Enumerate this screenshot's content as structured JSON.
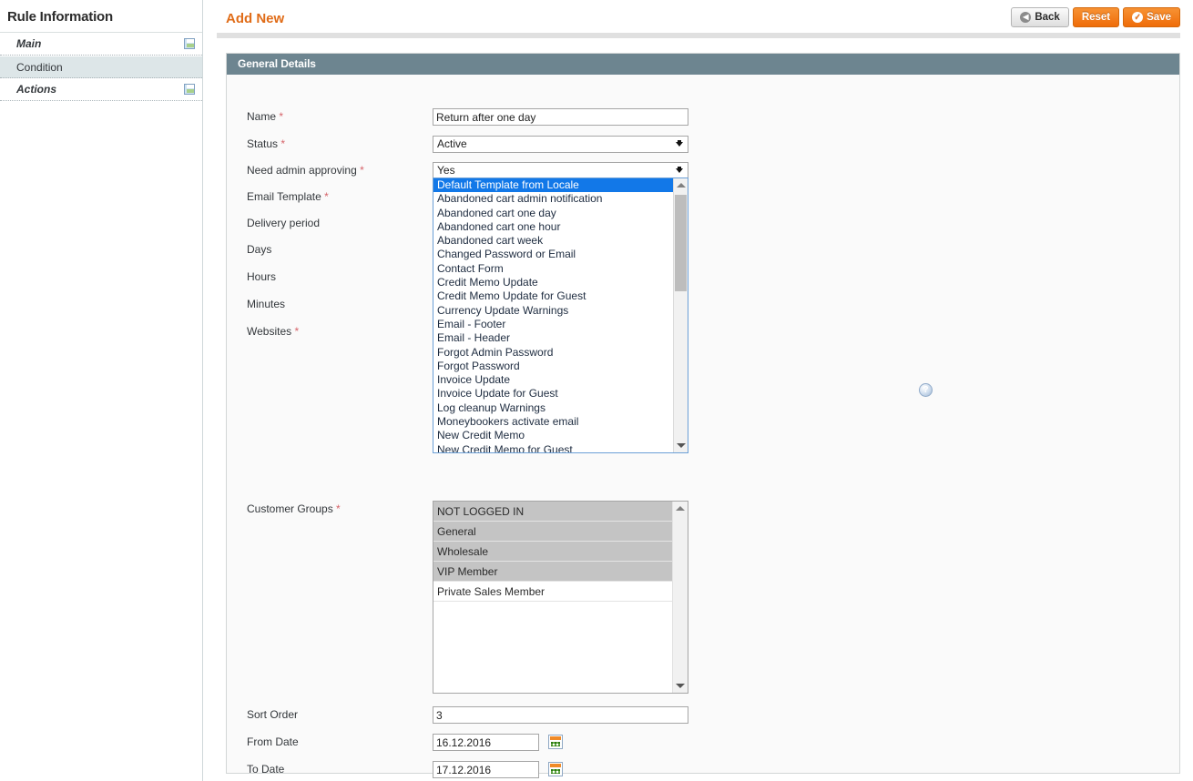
{
  "sidebar": {
    "title": "Rule Information",
    "items": [
      {
        "label": "Main",
        "state": "default",
        "icon": "save-disk-icon",
        "has_icon": true
      },
      {
        "label": "Condition",
        "state": "active",
        "icon": "",
        "has_icon": false
      },
      {
        "label": "Actions",
        "state": "default",
        "icon": "save-disk-icon",
        "has_icon": true
      }
    ]
  },
  "header": {
    "title": "Add New",
    "buttons": [
      {
        "label": "Back",
        "style": "grey",
        "icon": "back-arrow-icon"
      },
      {
        "label": "Reset",
        "style": "orange",
        "icon": ""
      },
      {
        "label": "Save",
        "style": "orange",
        "icon": "check-circle-icon"
      }
    ]
  },
  "panel": {
    "title": "General Details",
    "fields": {
      "name": {
        "label": "Name",
        "required": true,
        "value": "Return after one day"
      },
      "status": {
        "label": "Status",
        "required": true,
        "value": "Active"
      },
      "need_approving": {
        "label": "Need admin approving",
        "required": true,
        "value": "Yes"
      },
      "email_template": {
        "label": "Email Template",
        "required": true,
        "value": "Default Template from Locale"
      },
      "delivery_period": {
        "label": "Delivery period",
        "required": false,
        "value": ""
      },
      "days": {
        "label": "Days",
        "required": false,
        "value": ""
      },
      "hours": {
        "label": "Hours",
        "required": false,
        "value": ""
      },
      "minutes": {
        "label": "Minutes",
        "required": false,
        "value": ""
      },
      "websites": {
        "label": "Websites",
        "required": true,
        "value": ""
      },
      "customer_groups": {
        "label": "Customer Groups",
        "required": true
      },
      "sort_order": {
        "label": "Sort Order",
        "required": false,
        "value": "3"
      },
      "from_date": {
        "label": "From Date",
        "required": false,
        "value": "16.12.2016"
      },
      "to_date": {
        "label": "To Date",
        "required": false,
        "value": "17.12.2016"
      }
    },
    "email_template_options": [
      {
        "label": "Default Template from Locale",
        "selected": true
      },
      {
        "label": "Abandoned cart admin notification",
        "selected": false
      },
      {
        "label": "Abandoned cart one day",
        "selected": false
      },
      {
        "label": "Abandoned cart one hour",
        "selected": false
      },
      {
        "label": "Abandoned cart week",
        "selected": false
      },
      {
        "label": "Changed Password or Email",
        "selected": false
      },
      {
        "label": "Contact Form",
        "selected": false
      },
      {
        "label": "Credit Memo Update",
        "selected": false
      },
      {
        "label": "Credit Memo Update for Guest",
        "selected": false
      },
      {
        "label": "Currency Update Warnings",
        "selected": false
      },
      {
        "label": "Email - Footer",
        "selected": false
      },
      {
        "label": "Email - Header",
        "selected": false
      },
      {
        "label": "Forgot Admin Password",
        "selected": false
      },
      {
        "label": "Forgot Password",
        "selected": false
      },
      {
        "label": "Invoice Update",
        "selected": false
      },
      {
        "label": "Invoice Update for Guest",
        "selected": false
      },
      {
        "label": "Log cleanup Warnings",
        "selected": false
      },
      {
        "label": "Moneybookers activate email",
        "selected": false
      },
      {
        "label": "New Credit Memo",
        "selected": false
      },
      {
        "label": "New Credit Memo for Guest",
        "selected": false
      }
    ],
    "customer_group_options": [
      {
        "label": "NOT LOGGED IN",
        "selected": true
      },
      {
        "label": "General",
        "selected": true
      },
      {
        "label": "Wholesale",
        "selected": true
      },
      {
        "label": "VIP Member",
        "selected": true
      },
      {
        "label": "Private Sales Member",
        "selected": false
      }
    ],
    "help_icon": "?",
    "calendar_icon": "calendar-icon"
  },
  "colors": {
    "accent_orange": "#e06c18",
    "panel_header": "#6d8590",
    "select_highlight": "#1278e8",
    "required_star": "#d6646a"
  }
}
